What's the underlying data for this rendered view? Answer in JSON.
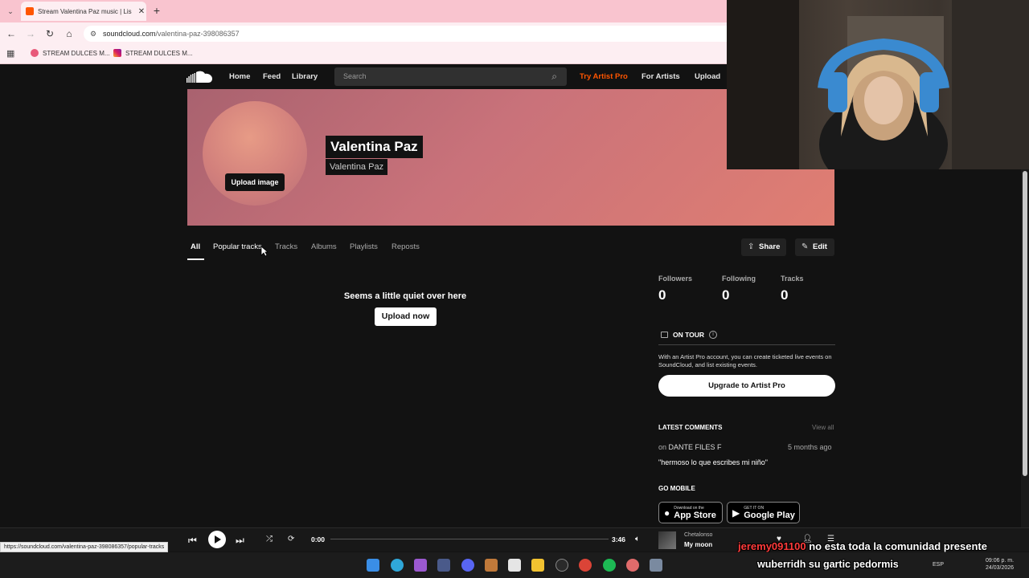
{
  "browser": {
    "tab_title": "Stream Valentina Paz music | Lis",
    "url_host": "soundcloud.com",
    "url_path": "/valentina-paz-398086357",
    "bookmarks": [
      "STREAM DULCES M...",
      "STREAM DULCES M..."
    ],
    "status_url": "https://soundcloud.com/valentina-paz-398086357/popular-tracks"
  },
  "header": {
    "nav": [
      "Home",
      "Feed",
      "Library"
    ],
    "search_placeholder": "Search",
    "try_pro": "Try Artist Pro",
    "for_artists": "For Artists",
    "upload": "Upload"
  },
  "profile": {
    "display_name": "Valentina Paz",
    "username": "Valentina Paz",
    "upload_image": "Upload image"
  },
  "tabs": [
    "All",
    "Popular tracks",
    "Tracks",
    "Albums",
    "Playlists",
    "Reposts"
  ],
  "actions": {
    "share": "Share",
    "edit": "Edit"
  },
  "empty": {
    "message": "Seems a little quiet over here",
    "upload_now": "Upload now"
  },
  "stats": [
    {
      "label": "Followers",
      "value": "0"
    },
    {
      "label": "Following",
      "value": "0"
    },
    {
      "label": "Tracks",
      "value": "0"
    }
  ],
  "tour": {
    "title": "ON TOUR",
    "text": "With an Artist Pro account, you can create ticketed live events on SoundCloud, and list existing events.",
    "upgrade": "Upgrade to Artist Pro"
  },
  "comments": {
    "title": "LATEST COMMENTS",
    "view_all": "View all",
    "on_prefix": "on",
    "track": "DANTE FILES F",
    "time": "5 months ago",
    "text": "\"hermoso lo que escribes mi niño\""
  },
  "mobile": {
    "title": "GO MOBILE",
    "app_store_small": "Download on the",
    "app_store": "App Store",
    "google_small": "GET IT ON",
    "google": "Google Play"
  },
  "player": {
    "time_current": "0:00",
    "time_total": "3:46",
    "artist": "Chetalonso",
    "title": "My moon"
  },
  "chat": [
    {
      "user": "jeremy091100",
      "message": "no esta toda la comunidad presente"
    },
    {
      "user": "wuberridh",
      "message": "su gartic pedormis"
    }
  ],
  "taskbar": {
    "lang": "ESP",
    "time": "09:06 p. m.",
    "date": "24/03/2026"
  },
  "colors": {
    "accent": "#ff5500",
    "background": "#121212"
  }
}
